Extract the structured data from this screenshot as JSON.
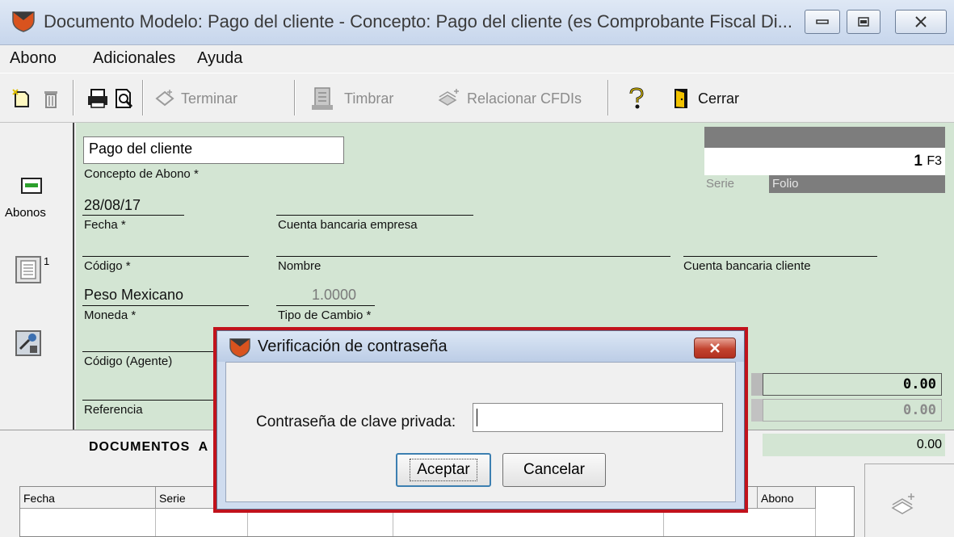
{
  "window": {
    "title": "Documento Modelo: Pago del cliente - Concepto: Pago del cliente (es Comprobante Fiscal Di...",
    "controls": [
      "minimize",
      "maximize",
      "close"
    ]
  },
  "menu": [
    "Abono",
    "Adicionales",
    "Ayuda"
  ],
  "toolbar": {
    "terminar": "Terminar",
    "timbrar": "Timbrar",
    "relacionar": "Relacionar CFDIs",
    "cerrar": "Cerrar"
  },
  "sidebar": {
    "abonos_label": "Abonos",
    "badge": "1"
  },
  "form": {
    "concepto_value": "Pago del cliente",
    "concepto_label": "Concepto de Abono *",
    "serie_label": "Serie",
    "folio_label": "Folio",
    "folio_value": "1",
    "folio_key": "F3",
    "fecha_value": "28/08/17",
    "fecha_label": "Fecha *",
    "cuenta_empresa_label": "Cuenta bancaria empresa",
    "codigo_label": "Código *",
    "nombre_label": "Nombre",
    "cuenta_cliente_label": "Cuenta bancaria cliente",
    "moneda_value": "Peso Mexicano",
    "moneda_label": "Moneda *",
    "tipo_cambio_value": "1.0000",
    "tipo_cambio_label": "Tipo de Cambio *",
    "agente_label": "Código (Agente)",
    "referencia_label": "Referencia",
    "total_1": "0.00",
    "total_2": "0.00"
  },
  "documents": {
    "heading": "DOCUMENTOS  A",
    "total": "0.00",
    "columns": [
      "Fecha",
      "Serie",
      "Abono"
    ]
  },
  "dialog": {
    "title": "Verificación de contraseña",
    "field_label": "Contraseña de clave privada:",
    "field_value": "",
    "accept": "Aceptar",
    "cancel": "Cancelar"
  },
  "colors": {
    "form_green": "#d3e5d3",
    "highlight_red": "#c1121c",
    "header_gray": "#7d7d7d"
  }
}
